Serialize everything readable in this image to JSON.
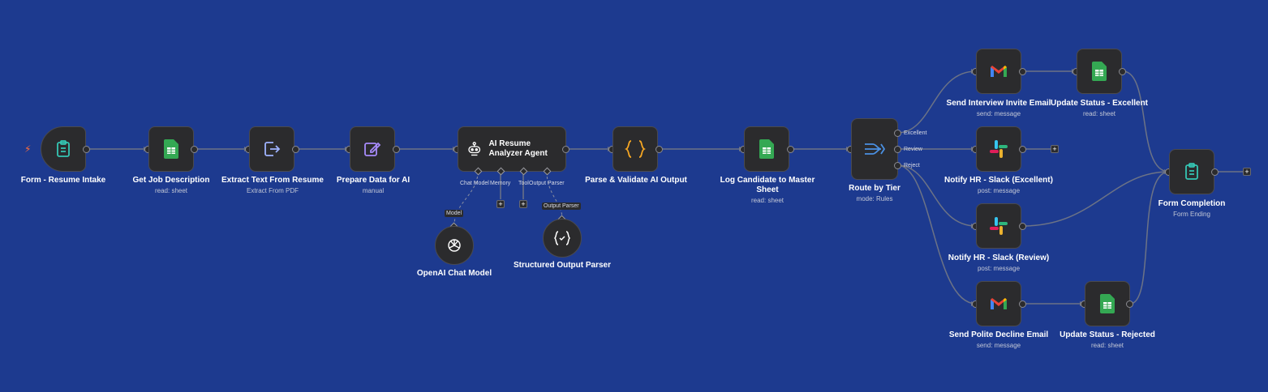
{
  "nodes": {
    "form_intake": {
      "title": "Form - Resume Intake"
    },
    "get_job": {
      "title": "Get Job Description",
      "sub": "read: sheet"
    },
    "extract_text": {
      "title": "Extract Text From Resume",
      "sub": "Extract From PDF"
    },
    "prepare_data": {
      "title": "Prepare Data for AI",
      "sub": "manual"
    },
    "agent": {
      "title": "AI Resume Analyzer Agent"
    },
    "parse_validate": {
      "title": "Parse & Validate AI Output"
    },
    "log_candidate": {
      "title": "Log Candidate to Master Sheet",
      "sub": "read: sheet"
    },
    "route": {
      "title": "Route by Tier",
      "sub": "mode: Rules"
    },
    "interview_email": {
      "title": "Send Interview Invite Email",
      "sub": "send: message"
    },
    "update_excellent": {
      "title": "Update Status - Excellent",
      "sub": "read: sheet"
    },
    "slack_excellent": {
      "title": "Notify HR - Slack (Excellent)",
      "sub": "post: message"
    },
    "slack_review": {
      "title": "Notify HR - Slack (Review)",
      "sub": "post: message"
    },
    "decline_email": {
      "title": "Send Polite Decline Email",
      "sub": "send: message"
    },
    "update_rejected": {
      "title": "Update Status - Rejected",
      "sub": "read: sheet"
    },
    "form_completion": {
      "title": "Form Completion",
      "sub": "Form Ending"
    },
    "openai": {
      "title": "OpenAI Chat Model"
    },
    "output_parser": {
      "title": "Structured Output Parser"
    }
  },
  "agent_ports": {
    "chat_model": "Chat Model",
    "memory": "Memory",
    "tool": "Tool",
    "output_parser": "Output Parser"
  },
  "sub_tags": {
    "model": "Model",
    "parser": "Output Parser"
  },
  "route_outputs": {
    "excellent": "Excellent",
    "review": "Review",
    "reject": "Reject"
  },
  "plus_symbol": "+",
  "colors": {
    "canvas": "#1d3a8f",
    "node": "#2b2b2d",
    "wire": "#6c7386",
    "sheets": "#34a853",
    "trigger_icon": "#35c6b4",
    "code_icon": "#f5a623",
    "router_icon": "#4a90e2"
  },
  "icons": {
    "form": "clipboard-icon",
    "sheet": "google-sheets-icon",
    "extract": "export-file-icon",
    "prepare": "pencil-icon",
    "agent": "robot-icon",
    "code": "braces-icon",
    "router": "split-arrows-icon",
    "gmail": "gmail-icon",
    "slack": "slack-icon",
    "openai": "openai-icon",
    "parser": "braces-check-icon"
  }
}
